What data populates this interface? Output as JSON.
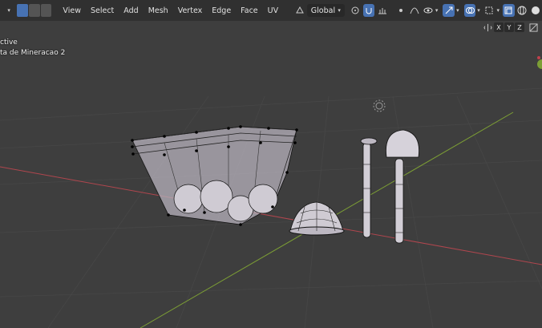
{
  "header": {
    "mode_buttons": [
      "vertex-select",
      "edge-select",
      "face-select"
    ],
    "menus": [
      "View",
      "Select",
      "Add",
      "Mesh",
      "Vertex",
      "Edge",
      "Face",
      "UV"
    ],
    "transform_orientation": "Global"
  },
  "overlay": {
    "line1": "ctive",
    "line2": "ta de Mineracao 2"
  },
  "axis_toggles": [
    "X",
    "Y",
    "Z"
  ],
  "colors": {
    "header_bg": "#303030",
    "viewport_bg": "#3e3e3e",
    "accent": "#4772b3",
    "x_axis": "#b0464e",
    "y_axis": "#7c9e35",
    "grid": "#474747"
  }
}
